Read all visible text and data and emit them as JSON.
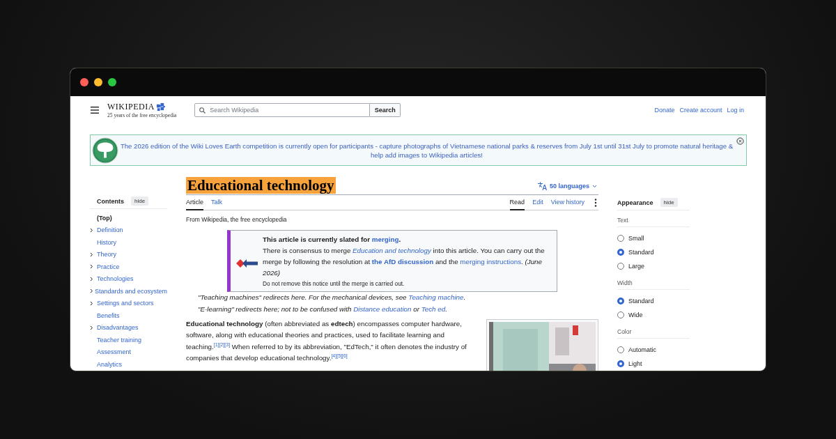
{
  "window": {
    "controls": [
      {
        "color": "#ff5f57"
      },
      {
        "color": "#febc2e"
      },
      {
        "color": "#28c840"
      }
    ]
  },
  "header": {
    "logo": {
      "wordmark": "WIKIPEDIA",
      "tagline": "25 years of the free encyclopedia"
    },
    "search": {
      "placeholder": "Search Wikipedia",
      "button": "Search"
    },
    "links": [
      "Donate",
      "Create account",
      "Log in"
    ]
  },
  "banner": {
    "text": "The 2026 edition of the Wiki Loves Earth competition is currently open for participants - capture photographs of Vietnamese national parks & reserves from July 1st until 31st July to promote natural heritage & help add images to Wikipedia articles!"
  },
  "toc": {
    "title": "Contents",
    "hide": "hide",
    "items": [
      {
        "label": "(Top)",
        "expandable": false,
        "selected": true
      },
      {
        "label": "Definition",
        "expandable": true,
        "selected": false
      },
      {
        "label": "History",
        "expandable": false,
        "selected": false
      },
      {
        "label": "Theory",
        "expandable": true,
        "selected": false
      },
      {
        "label": "Practice",
        "expandable": true,
        "selected": false
      },
      {
        "label": "Technologies",
        "expandable": true,
        "selected": false
      },
      {
        "label": "Standards and ecosystem",
        "expandable": true,
        "selected": false
      },
      {
        "label": "Settings and sectors",
        "expandable": true,
        "selected": false
      },
      {
        "label": "Benefits",
        "expandable": false,
        "selected": false
      },
      {
        "label": "Disadvantages",
        "expandable": true,
        "selected": false
      },
      {
        "label": "Teacher training",
        "expandable": false,
        "selected": false
      },
      {
        "label": "Assessment",
        "expandable": false,
        "selected": false
      },
      {
        "label": "Analytics",
        "expandable": false,
        "selected": false
      }
    ]
  },
  "article": {
    "title": "Educational technology",
    "highlighted": true,
    "languages": "50 languages",
    "tabs_left": [
      {
        "label": "Article",
        "selected": true
      },
      {
        "label": "Talk",
        "selected": false
      }
    ],
    "tabs_right": [
      {
        "label": "Read",
        "selected": true
      },
      {
        "label": "Edit",
        "selected": false
      },
      {
        "label": "View history",
        "selected": false
      }
    ],
    "tagline": "From Wikipedia, the free encyclopedia",
    "notice": {
      "title": [
        {
          "kind": "text",
          "text": "This article is currently slated for "
        },
        {
          "kind": "link",
          "text": "merging",
          "bold": true
        },
        {
          "kind": "text",
          "text": "."
        }
      ],
      "body": [
        {
          "kind": "text",
          "text": "There is consensus to merge "
        },
        {
          "kind": "link",
          "text": "Education and technology",
          "italic": true
        },
        {
          "kind": "text",
          "text": " into this article. You can carry out the merge by following the resolution at "
        },
        {
          "kind": "link",
          "text": "the AfD discussion",
          "bold": true
        },
        {
          "kind": "text",
          "text": " and the "
        },
        {
          "kind": "link",
          "text": "merging instructions"
        },
        {
          "kind": "text",
          "text": ". *(June 2026)*"
        }
      ],
      "note": "Do not remove this notice until the merge is carried out."
    },
    "hatnotes": [
      [
        {
          "kind": "text",
          "text": "\"Teaching machines\" redirects here. For the mechanical devices, see "
        },
        {
          "kind": "link",
          "text": "Teaching machine"
        },
        {
          "kind": "text",
          "text": "."
        }
      ],
      [
        {
          "kind": "text",
          "text": "\"E-learning\" redirects here; not to be confused with "
        },
        {
          "kind": "link",
          "text": "Distance education"
        },
        {
          "kind": "text",
          "text": " or "
        },
        {
          "kind": "link",
          "text": "Tech ed"
        },
        {
          "kind": "text",
          "text": "."
        }
      ]
    ],
    "image": {
      "kind": "picture"
    },
    "paragraph": [
      {
        "kind": "text",
        "text": "**Educational technology** (often abbreviated as **edtech**) encompasses computer hardware, software, along with educational theories and practices, used to facilitate learning and teaching."
      },
      {
        "kind": "ref",
        "text": "[1][2][3]"
      },
      {
        "kind": "text",
        "text": " When referred to by its abbreviation, \"EdTech,\" it often denotes the industry of companies that develop educational technology."
      },
      {
        "kind": "ref",
        "text": "[4][5][6]"
      }
    ]
  },
  "appearance": {
    "title": "Appearance",
    "hide": "hide",
    "groups": [
      {
        "label": "Text",
        "options": [
          {
            "label": "Small",
            "selected": false
          },
          {
            "label": "Standard",
            "selected": true
          },
          {
            "label": "Large",
            "selected": false
          }
        ]
      },
      {
        "label": "Width",
        "options": [
          {
            "label": "Standard",
            "selected": true
          },
          {
            "label": "Wide",
            "selected": false
          }
        ]
      },
      {
        "label": "Color",
        "options": [
          {
            "label": "Automatic",
            "selected": false
          },
          {
            "label": "Light",
            "selected": true
          }
        ]
      }
    ]
  }
}
